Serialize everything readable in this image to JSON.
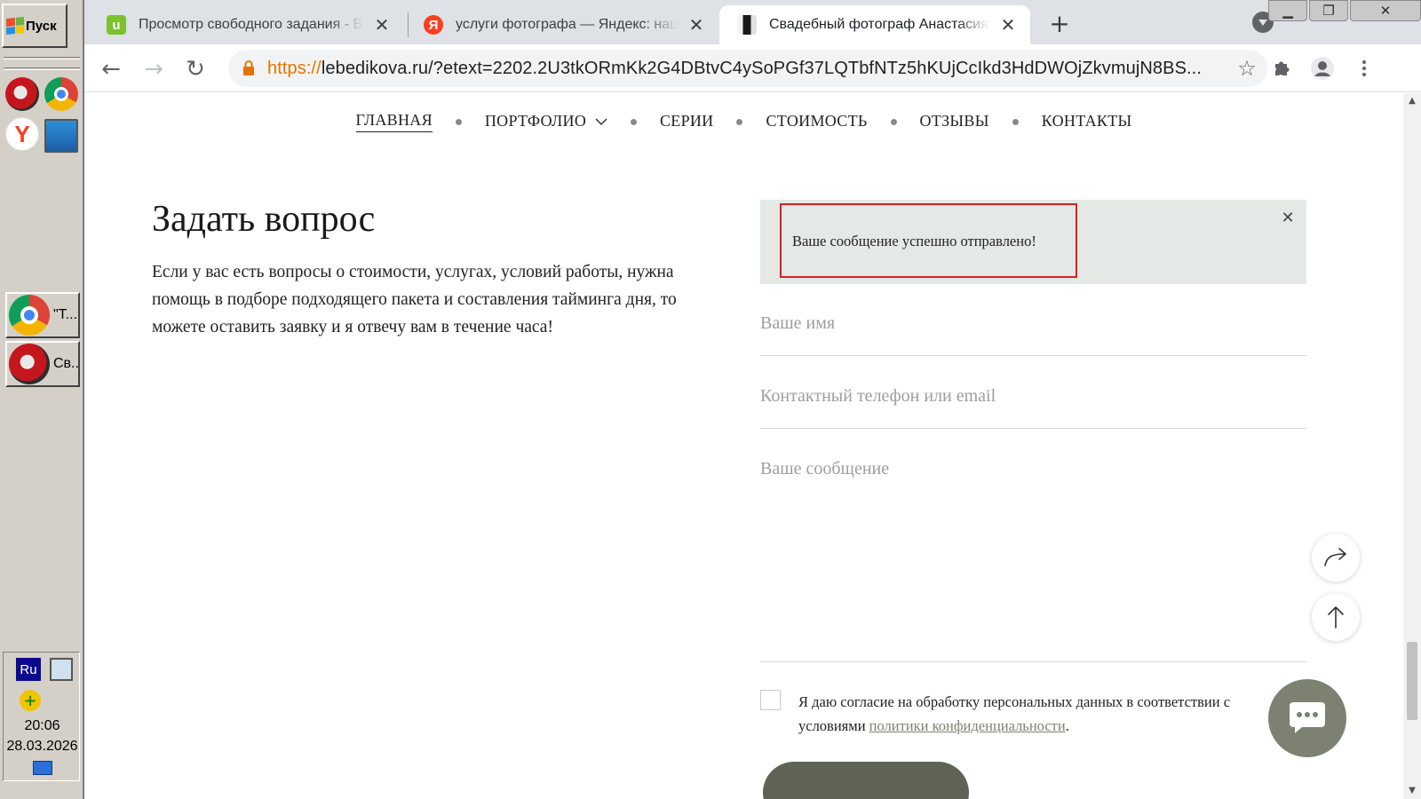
{
  "taskbar": {
    "start_label": "Пуск",
    "tasks": [
      {
        "label": "\"Т..."
      },
      {
        "label": "Св..."
      }
    ],
    "tray": {
      "language": "Ru",
      "time": "20:06",
      "date": "28.03.2026"
    }
  },
  "browser": {
    "tabs": [
      {
        "title": "Просмотр свободного задания - В",
        "favicon": "u",
        "favicon_color": "#7cc22e"
      },
      {
        "title": "услуги фотографа — Яндекс: наш",
        "favicon": "Я",
        "favicon_color": "#fc3f1d"
      },
      {
        "title": "Свадебный фотограф Анастасия Л",
        "favicon": "photo",
        "active": true
      }
    ],
    "url_scheme": "https://",
    "url_rest": "lebedikova.ru/?etext=2202.2U3tkORmKk2G4DBtvC4ySoPGf37LQTbfNTz5hKUjCcIkd3HdDWOjZkvmujN8BS..."
  },
  "page": {
    "nav": [
      {
        "label": "ГЛАВНАЯ",
        "active": true
      },
      {
        "label": "ПОРТФОЛИО"
      },
      {
        "label": "СЕРИИ"
      },
      {
        "label": "СТОИМОСТЬ"
      },
      {
        "label": "ОТЗЫВЫ"
      },
      {
        "label": "КОНТАКТЫ"
      }
    ],
    "ask": {
      "title": "Задать вопрос",
      "text": "Если у вас есть вопросы о стоимости, услугах, условий работы, нужна помощь в подборе подходящего пакета и составления тайминга дня, то можете оставить заявку и я отвечу вам в течение часа!"
    },
    "success_message": "Ваше сообщение успешно отправлено!",
    "form": {
      "name_placeholder": "Ваше имя",
      "contact_placeholder": "Контактный телефон или email",
      "message_placeholder": "Ваше сообщение",
      "consent_text": "Я даю согласие на обработку персональных данных в соответствии с условиями ",
      "consent_link": "политики конфиденциальности",
      "consent_end": "."
    }
  },
  "colors": {
    "accent_olive": "#7d8171",
    "success_bg": "#e4e9e5",
    "highlight_red": "#d42020",
    "url_scheme": "#e37400"
  }
}
